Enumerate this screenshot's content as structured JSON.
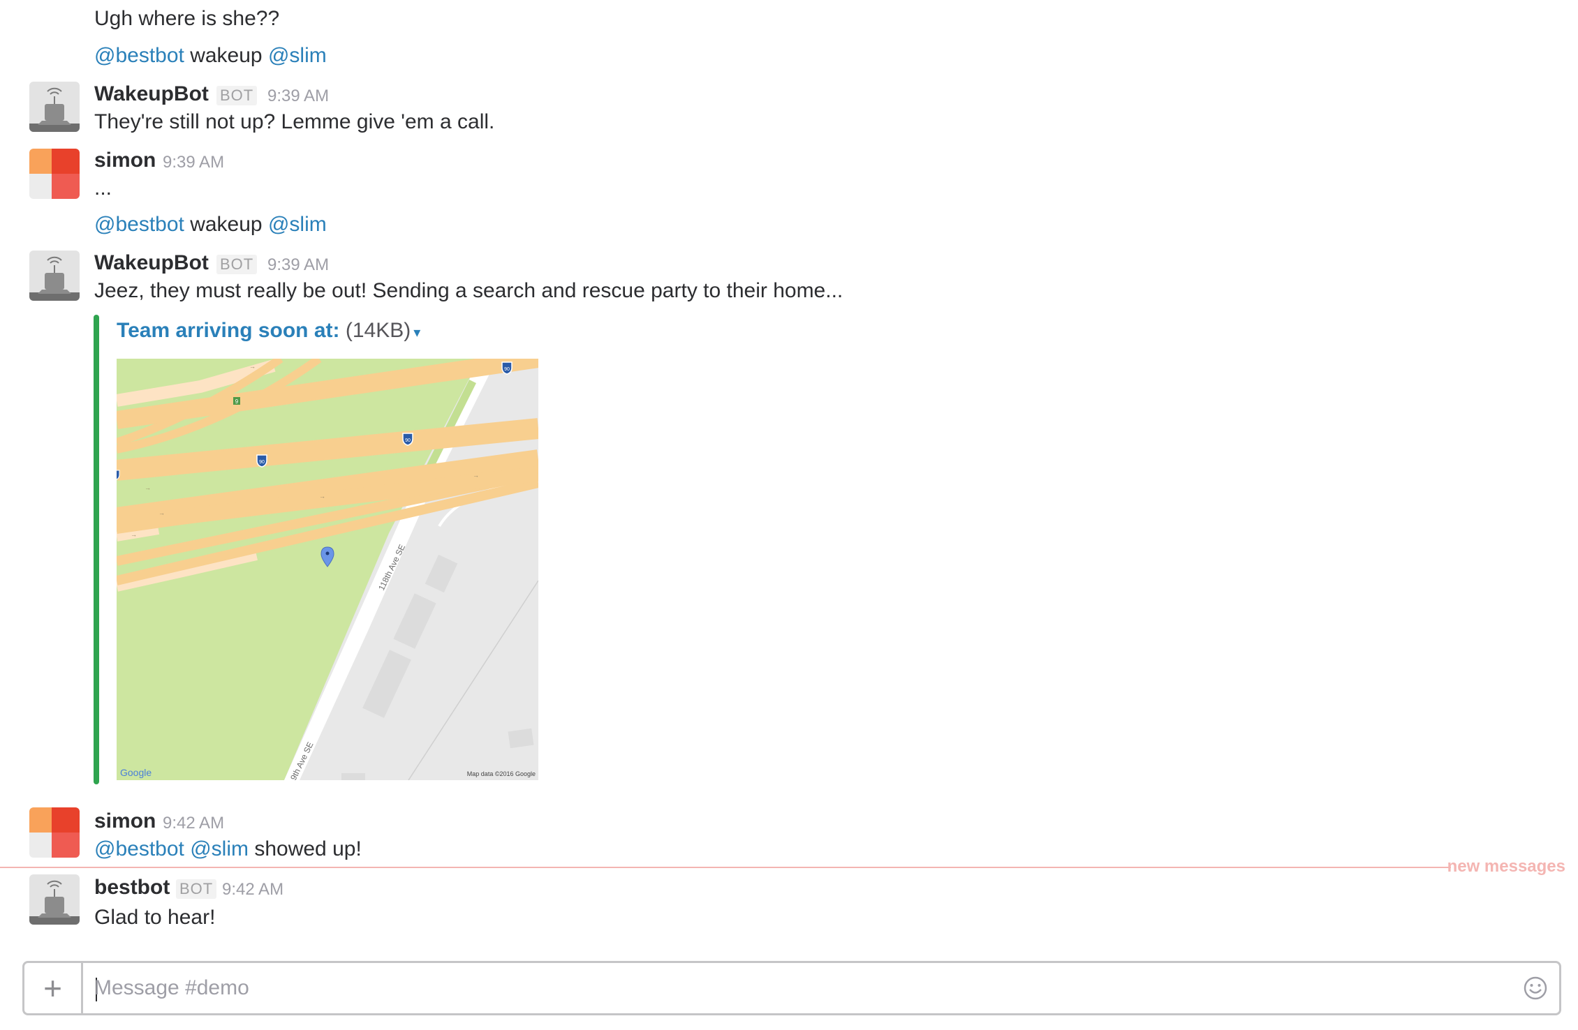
{
  "messages": {
    "m1": {
      "text": "Ugh where is she??"
    },
    "m2": {
      "mention1": "@bestbot",
      "word": " wakeup ",
      "mention2": "@slim"
    },
    "m3": {
      "sender": "WakeupBot",
      "bot_tag": "BOT",
      "time": "9:39 AM",
      "text": "They're still not up? Lemme give 'em a call."
    },
    "m4": {
      "sender": "simon",
      "time": "9:39 AM",
      "text": "..."
    },
    "m5": {
      "mention1": "@bestbot",
      "word": " wakeup ",
      "mention2": "@slim"
    },
    "m6": {
      "sender": "WakeupBot",
      "bot_tag": "BOT",
      "time": "9:39 AM",
      "text": "Jeez, they must really be out! Sending a search and rescue party to their home...",
      "attachment": {
        "title": "Team arriving soon at:",
        "size": "(14KB)",
        "map": {
          "road_label_1": "118th Ave SE",
          "road_label_2": "9th Ave SE",
          "google_logo": "Google",
          "copyright": "Map data ©2016 Google",
          "shield_label": "90",
          "exit_label": "9"
        }
      }
    },
    "m7": {
      "sender": "simon",
      "time": "9:42 AM",
      "mention1": "@bestbot",
      "mention2": "@slim",
      "text": " showed up!"
    },
    "m8": {
      "sender": "bestbot",
      "bot_tag": "BOT",
      "time": "9:42 AM",
      "text": "Glad to hear!"
    }
  },
  "divider": {
    "label": "new messages"
  },
  "composer": {
    "plus": "+",
    "placeholder": "Message #demo"
  },
  "colors": {
    "mention": "#2a80b9",
    "attachment_bar": "#2fa44f",
    "new_messages": "#f4b5b2",
    "map_park": "#cde6a0",
    "map_highway": "#f8cf8f",
    "map_ground": "#e8e8e8"
  },
  "icons": {
    "bot_avatar": "robot-antenna-icon",
    "user_avatar": "orange-red-squares-avatar",
    "caret": "caret-down-icon",
    "emoji": "smiley-face-icon",
    "map_pin": "map-pin-icon"
  }
}
